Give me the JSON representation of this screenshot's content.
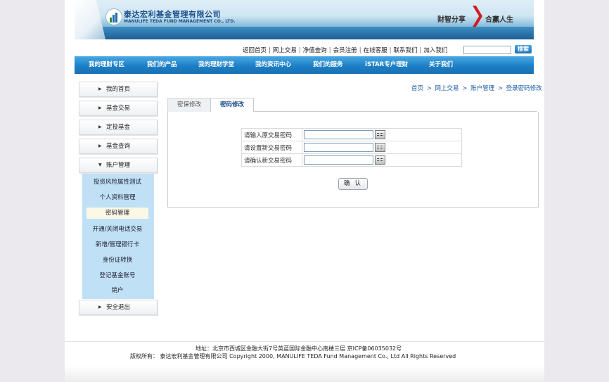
{
  "header": {
    "logo_cn": "泰达宏利基金管理有限公司",
    "logo_en": "MANULIFE TEDA FUND MANAGEMENT CO., LTD.",
    "slogan_left": "财智分享",
    "slogan_right": "合赢人生"
  },
  "toplinks": [
    "返回首页",
    "网上交易",
    "净值查询",
    "会员注册",
    "在线客服",
    "联系我们",
    "加入我们"
  ],
  "search": {
    "button_label": "搜索",
    "value": ""
  },
  "nav": [
    "我的理财专区",
    "我们的产品",
    "我的理财学堂",
    "我的资讯中心",
    "我们的服务",
    "iSTAR专户理财",
    "关于我们"
  ],
  "sidebar": {
    "items": [
      {
        "label": "我的首页",
        "arrow": "▶"
      },
      {
        "label": "基金交易",
        "arrow": "▶"
      },
      {
        "label": "定投基金",
        "arrow": "▶"
      },
      {
        "label": "基金查询",
        "arrow": "▶"
      },
      {
        "label": "账户管理",
        "arrow": "▼"
      }
    ],
    "submenu": [
      "投资风险属性测试",
      "个人资料管理",
      "密码管理",
      "开通/关闭电话交易",
      "新增/管理银行卡",
      "身份证转换",
      "登记基金账号",
      "销户"
    ],
    "logout": {
      "label": "安全退出",
      "arrow": "▶"
    }
  },
  "breadcrumb": [
    "首页",
    "网上交易",
    "账户管理",
    "登录密码修改"
  ],
  "breadcrumb_sep": ">",
  "tabs": [
    "密保修改",
    "密码修改"
  ],
  "form": {
    "rows": [
      {
        "label": "请输入原交易密码",
        "value": ""
      },
      {
        "label": "请设置新交易密码",
        "value": ""
      },
      {
        "label": "请确认新交易密码",
        "value": ""
      }
    ],
    "submit_label": "确 认"
  },
  "footer": {
    "address": "地址：北京市西城区金融大街7号英蓝国际金融中心南楼三层 京ICP备06035032号",
    "copyright": "版权所有： 泰达宏利基金管理有限公司 Copyright 2000, MANULIFE TEDA Fund Management Co., Ltd All Rights Reserved"
  }
}
